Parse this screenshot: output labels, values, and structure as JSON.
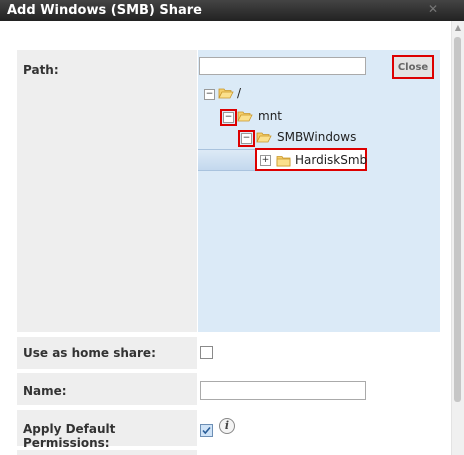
{
  "window": {
    "title": "Add Windows (SMB) Share",
    "close_glyph": "✕"
  },
  "form": {
    "path": {
      "label": "Path:",
      "value": "",
      "close_button": "Close",
      "tree": [
        {
          "label": "/",
          "toggle": "−"
        },
        {
          "label": "mnt",
          "toggle": "−"
        },
        {
          "label": "SMBWindows",
          "toggle": "−"
        },
        {
          "label": "HardiskSmb",
          "toggle": "+"
        }
      ]
    },
    "home_share": {
      "label": "Use as home share:",
      "checked": false
    },
    "name": {
      "label": "Name:",
      "value": ""
    },
    "default_permissions": {
      "label": "Apply Default Permissions:",
      "checked": true,
      "info_glyph": "i"
    }
  },
  "colors": {
    "highlight": "#dd0000",
    "tree_bg": "#dbeaf7",
    "label_bg": "#eeeeee"
  }
}
